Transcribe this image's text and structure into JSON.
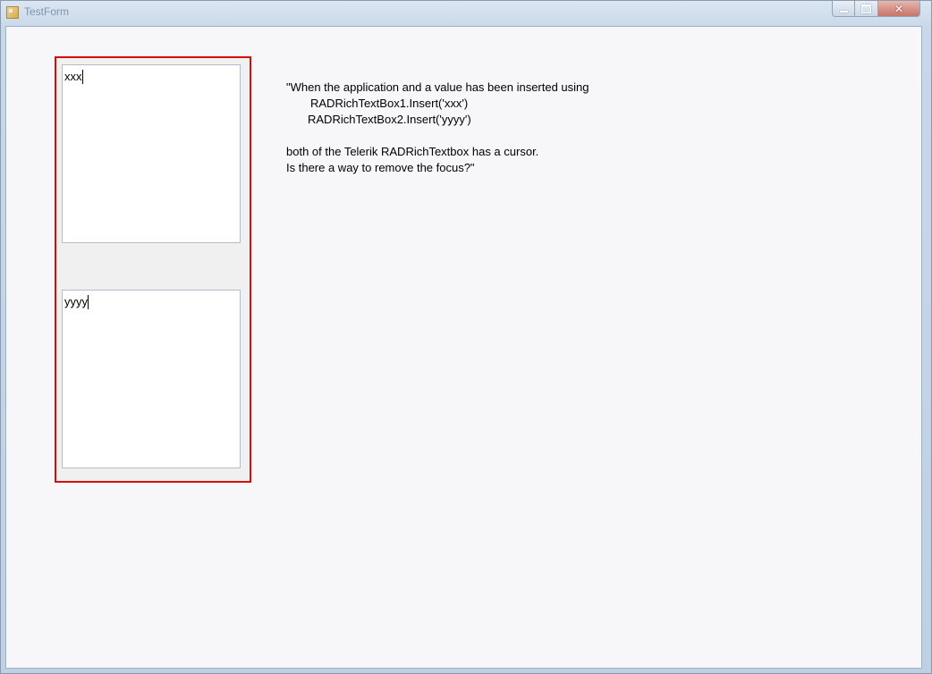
{
  "window": {
    "title": "TestForm",
    "caption_buttons": {
      "minimize": "minimize",
      "maximize": "maximize",
      "close": "✕"
    }
  },
  "textboxes": [
    {
      "name": "RADRichTextBox1",
      "value": "xxx"
    },
    {
      "name": "RADRichTextBox2",
      "value": "yyyy"
    }
  ],
  "description": {
    "line1": "\"When the application and a value has been inserted using",
    "line2": "RADRichTextBox1.Insert('xxx')",
    "line3": "RADRichTextBox2.Insert('yyyy')",
    "line4": "both of the Telerik RADRichTextbox has a cursor.",
    "line5": "Is there a way to remove the focus?\""
  },
  "colors": {
    "highlight_border": "#d20e0e",
    "form_background": "#f7f7f9",
    "textbox_background": "#ffffff"
  }
}
